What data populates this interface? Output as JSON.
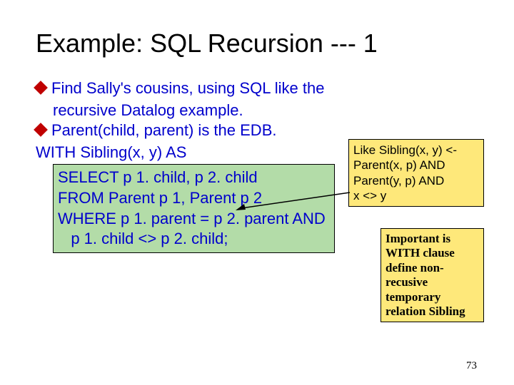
{
  "title": "Example: SQL Recursion --- 1",
  "bullets": {
    "b1a": "Find Sally's cousins, using SQL like the",
    "b1b": "recursive Datalog example.",
    "b2": "Parent(child, parent) is the EDB."
  },
  "with_line": "WITH Sibling(x, y) AS",
  "code": {
    "l1": "SELECT p 1. child, p 2. child",
    "l2": "FROM Parent p 1, Parent p 2",
    "l3": "WHERE p 1. parent = p 2. parent AND",
    "l4": "   p 1. child <> p 2. child;"
  },
  "callout1": {
    "l1": "Like Sibling(x, y) <-",
    "l2": "   Parent(x, p) AND",
    "l3": "   Parent(y, p) AND",
    "l4": "   x <> y"
  },
  "callout2": "Important is WITH clause define non-recusive temporary relation Sibling",
  "pagenum": "73"
}
